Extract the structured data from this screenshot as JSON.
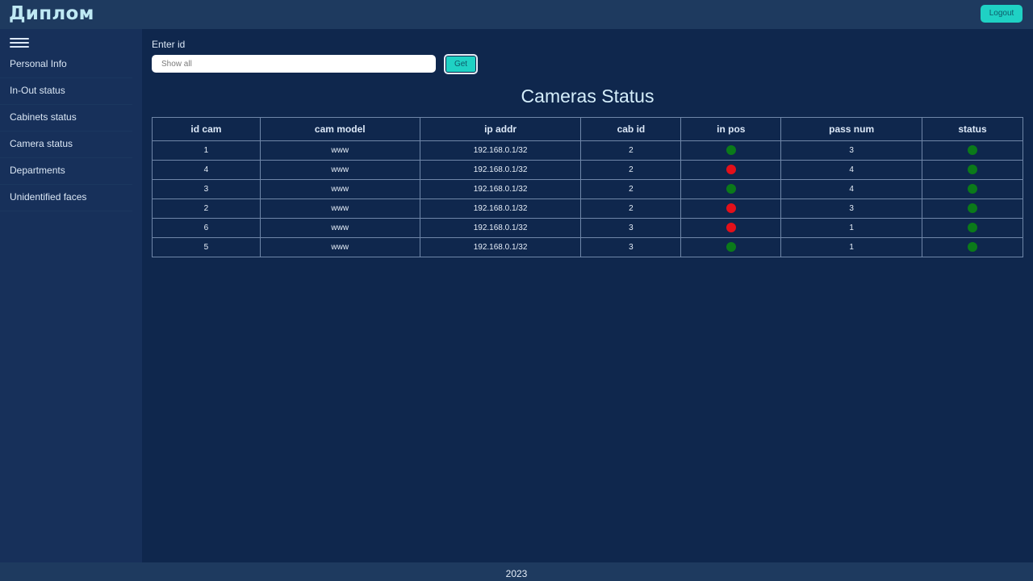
{
  "header": {
    "brand": "Диплом",
    "logout_label": "Logout"
  },
  "sidebar": {
    "menu_icon": "hamburger-menu-icon",
    "items": [
      {
        "label": "Personal Info"
      },
      {
        "label": "In-Out status"
      },
      {
        "label": "Cabinets status"
      },
      {
        "label": "Camera status"
      },
      {
        "label": "Departments"
      },
      {
        "label": "Unidentified faces"
      }
    ]
  },
  "search": {
    "label": "Enter id",
    "value": "",
    "placeholder": "Show all",
    "button_label": "Get"
  },
  "page_title": "Cameras Status",
  "colors": {
    "accent": "#1fd1c4",
    "ok": "#0b7a1a",
    "fail": "#e3101a"
  },
  "table": {
    "columns": [
      "id cam",
      "cam model",
      "ip addr",
      "cab id",
      "in pos",
      "pass num",
      "status"
    ],
    "rows": [
      {
        "id_cam": "1",
        "cam_model": "www",
        "ip_addr": "192.168.0.1/32",
        "cab_id": "2",
        "in_pos": "green",
        "pass_num": "3",
        "status": "green"
      },
      {
        "id_cam": "4",
        "cam_model": "www",
        "ip_addr": "192.168.0.1/32",
        "cab_id": "2",
        "in_pos": "red",
        "pass_num": "4",
        "status": "green"
      },
      {
        "id_cam": "3",
        "cam_model": "www",
        "ip_addr": "192.168.0.1/32",
        "cab_id": "2",
        "in_pos": "green",
        "pass_num": "4",
        "status": "green"
      },
      {
        "id_cam": "2",
        "cam_model": "www",
        "ip_addr": "192.168.0.1/32",
        "cab_id": "2",
        "in_pos": "red",
        "pass_num": "3",
        "status": "green"
      },
      {
        "id_cam": "6",
        "cam_model": "www",
        "ip_addr": "192.168.0.1/32",
        "cab_id": "3",
        "in_pos": "red",
        "pass_num": "1",
        "status": "green"
      },
      {
        "id_cam": "5",
        "cam_model": "www",
        "ip_addr": "192.168.0.1/32",
        "cab_id": "3",
        "in_pos": "green",
        "pass_num": "1",
        "status": "green"
      }
    ]
  },
  "footer": {
    "text": "2023"
  }
}
